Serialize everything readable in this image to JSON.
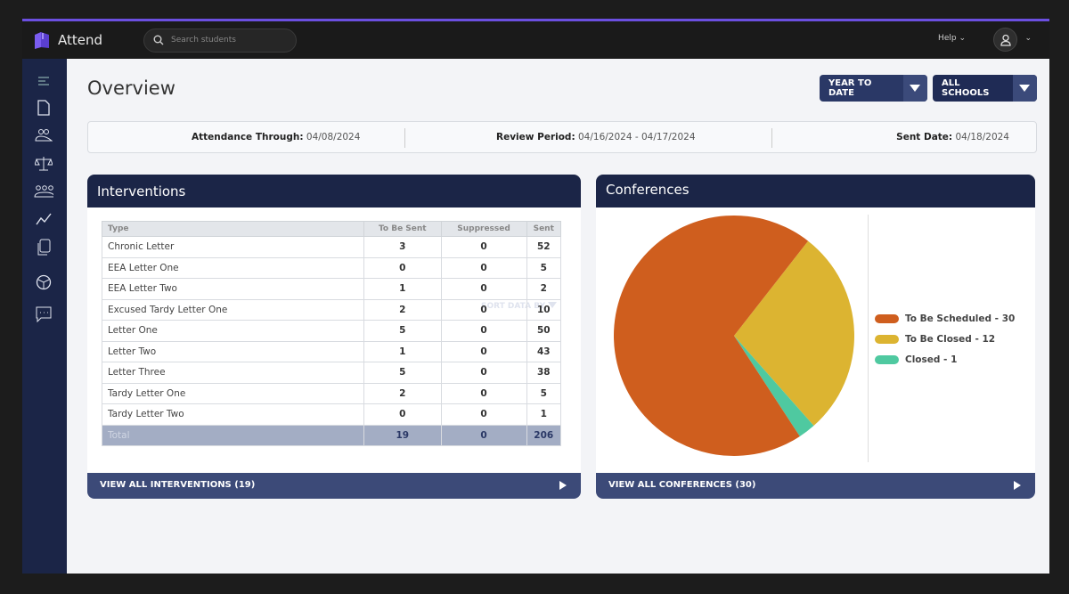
{
  "app": {
    "name": "Attend",
    "search_placeholder": "Search students",
    "help_label": "Help"
  },
  "sidebar": {
    "items": [
      {
        "icon": "menu-icon"
      },
      {
        "icon": "document-icon"
      },
      {
        "icon": "users-icon"
      },
      {
        "icon": "scale-icon"
      },
      {
        "icon": "group-icon"
      },
      {
        "icon": "chart-line-icon"
      },
      {
        "icon": "copy-icon"
      },
      {
        "icon": "globe-icon"
      },
      {
        "icon": "chat-icon"
      }
    ]
  },
  "page": {
    "title": "Overview",
    "period_filter": "YEAR TO DATE",
    "school_filter": "ALL SCHOOLS"
  },
  "info": {
    "attendance_label": "Attendance Through:",
    "attendance_value": "04/08/2024",
    "review_label": "Review Period:",
    "review_value": "04/16/2024 - 04/17/2024",
    "sent_label": "Sent Date:",
    "sent_value": "04/18/2024"
  },
  "interventions": {
    "title": "Interventions",
    "sort_label": "SORT DATA BY",
    "columns": [
      "Type",
      "To Be Sent",
      "Suppressed",
      "Sent"
    ],
    "rows": [
      [
        "Chronic Letter",
        "3",
        "0",
        "52"
      ],
      [
        "EEA Letter One",
        "0",
        "0",
        "5"
      ],
      [
        "EEA Letter Two",
        "1",
        "0",
        "2"
      ],
      [
        "Excused Tardy Letter One",
        "2",
        "0",
        "10"
      ],
      [
        "Letter One",
        "5",
        "0",
        "50"
      ],
      [
        "Letter Two",
        "1",
        "0",
        "43"
      ],
      [
        "Letter Three",
        "5",
        "0",
        "38"
      ],
      [
        "Tardy Letter One",
        "2",
        "0",
        "5"
      ],
      [
        "Tardy Letter Two",
        "0",
        "0",
        "1"
      ]
    ],
    "total": [
      "Total",
      "19",
      "0",
      "206"
    ],
    "footer": "VIEW ALL INTERVENTIONS (19)"
  },
  "conferences": {
    "title": "Conferences",
    "footer": "VIEW ALL CONFERENCES (30)"
  },
  "chart_data": {
    "type": "pie",
    "slices": [
      {
        "name": "To Be Closed",
        "value": 12,
        "color": "#dcb431",
        "label": "To Be Closed - 12"
      },
      {
        "name": "Closed",
        "value": 1,
        "color": "#4fc9a0",
        "label": "Closed - 1"
      },
      {
        "name": "To Be Scheduled",
        "value": 30,
        "color": "#cf5e1e",
        "label": "To Be Scheduled - 30"
      }
    ],
    "legend_order": [
      2,
      0,
      1
    ],
    "legend_position": "right"
  }
}
